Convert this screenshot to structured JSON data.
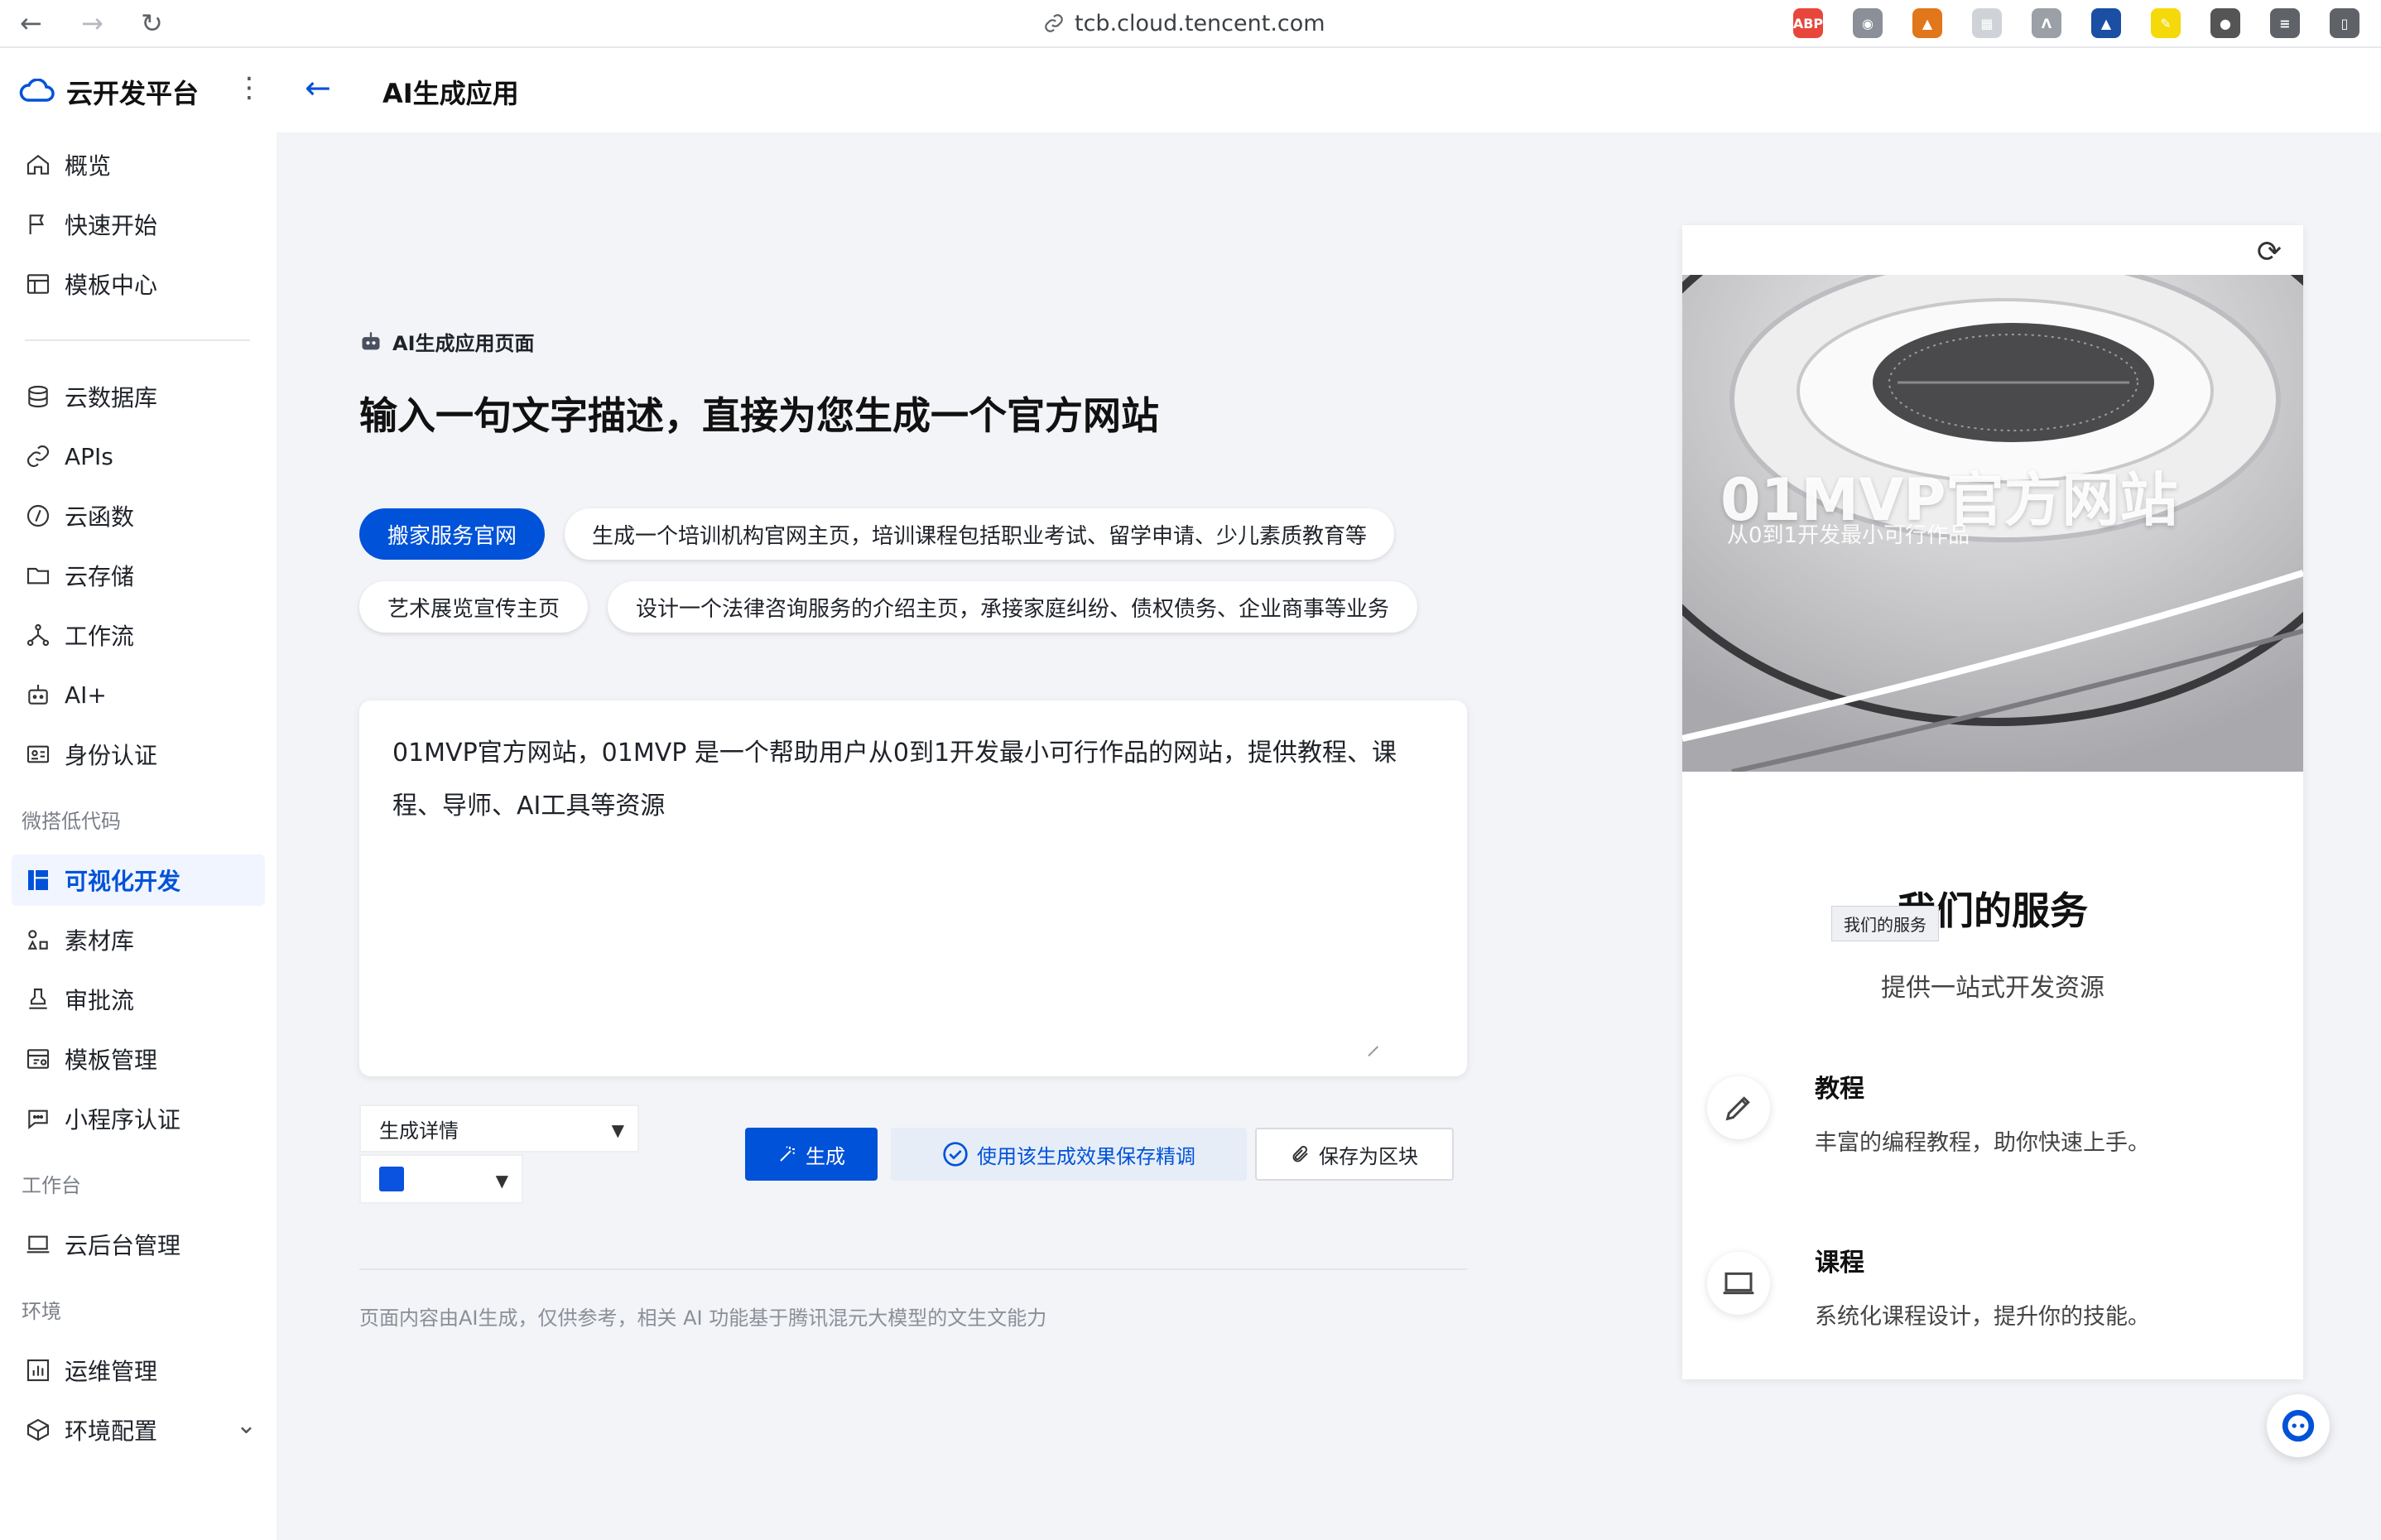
{
  "browser": {
    "url": "tcb.cloud.tencent.com",
    "back": "←",
    "forward": "→",
    "reload": "↻",
    "extensions": [
      {
        "icon": "adblock-icon",
        "label": "ABP",
        "color": "#e8463b"
      },
      {
        "icon": "camera-icon",
        "label": "◉",
        "color": "#8a8f98"
      },
      {
        "icon": "fox-icon",
        "label": "▲",
        "color": "#e2761b"
      },
      {
        "icon": "grid-icon",
        "label": "▦",
        "color": "#cfd3d8"
      },
      {
        "icon": "peak-icon",
        "label": "Λ",
        "color": "#9aa0a6"
      },
      {
        "icon": "mortarboard-icon",
        "label": "▲",
        "color": "#1a4fa3"
      },
      {
        "icon": "highlighter-icon",
        "label": "✎",
        "color": "#f5d90a"
      },
      {
        "icon": "avatar-ext-icon",
        "label": "●",
        "color": "#555555"
      },
      {
        "icon": "equalizer-icon",
        "label": "≡",
        "color": "#5f6368"
      },
      {
        "icon": "sidebar-toggle-icon",
        "label": "▯",
        "color": "#5f6368"
      }
    ]
  },
  "sidebar": {
    "brand": "云开发平台",
    "more": "⋮",
    "items_top": [
      {
        "name": "overview",
        "label": "概览",
        "icon": "home-icon"
      },
      {
        "name": "quick-start",
        "label": "快速开始",
        "icon": "flag-icon"
      },
      {
        "name": "template-center",
        "label": "模板中心",
        "icon": "template-icon"
      }
    ],
    "items_main": [
      {
        "name": "database",
        "label": "云数据库",
        "icon": "database-icon"
      },
      {
        "name": "apis",
        "label": "APIs",
        "icon": "link-icon"
      },
      {
        "name": "functions",
        "label": "云函数",
        "icon": "function-icon"
      },
      {
        "name": "storage",
        "label": "云存储",
        "icon": "folder-icon"
      },
      {
        "name": "workflow",
        "label": "工作流",
        "icon": "workflow-icon"
      },
      {
        "name": "ai-plus",
        "label": "AI+",
        "icon": "robot-icon"
      },
      {
        "name": "identity",
        "label": "身份认证",
        "icon": "id-card-icon"
      }
    ],
    "section_lowcode": "微搭低代码",
    "items_lowcode": [
      {
        "name": "visual-dev",
        "label": "可视化开发",
        "icon": "layout-icon",
        "active": true
      },
      {
        "name": "materials",
        "label": "素材库",
        "icon": "shapes-icon"
      },
      {
        "name": "approval",
        "label": "审批流",
        "icon": "stamp-icon"
      },
      {
        "name": "template-mgmt",
        "label": "模板管理",
        "icon": "template-manage-icon"
      },
      {
        "name": "miniprogram-auth",
        "label": "小程序认证",
        "icon": "chat-bubble-icon"
      }
    ],
    "section_workbench": "工作台",
    "items_workbench": [
      {
        "name": "cloud-admin",
        "label": "云后台管理",
        "icon": "laptop-icon"
      }
    ],
    "section_env": "环境",
    "items_env": [
      {
        "name": "ops",
        "label": "运维管理",
        "icon": "bar-chart-icon"
      },
      {
        "name": "env-config",
        "label": "环境配置",
        "icon": "cube-icon",
        "chevron": "⌄"
      }
    ]
  },
  "header": {
    "back": "←",
    "title": "AI生成应用"
  },
  "main": {
    "section_tag": "AI生成应用页面",
    "headline": "输入一句文字描述，直接为您生成一个官方网站",
    "chips": [
      "搬家服务官网",
      "生成一个培训机构官网主页，培训课程包括职业考试、留学申请、少儿素质教育等",
      "艺术展览宣传主页",
      "设计一个法律咨询服务的介绍主页，承接家庭纠纷、债权债务、企业商事等业务"
    ],
    "prompt_value": "01MVP官方网站，01MVP 是一个帮助用户从0到1开发最小可行作品的网站，提供教程、课程、导师、AI工具等资源",
    "detail_select": "生成详情",
    "color_swatch": "#0a52e0",
    "btn_generate": "生成",
    "btn_save_tune": "使用该生成效果保存精调",
    "btn_save_block": "保存为区块",
    "footnote": "页面内容由AI生成，仅供参考，相关 AI 功能基于腾讯混元大模型的文生文能力"
  },
  "preview": {
    "hero_title": "01MVP官方网站",
    "hero_subtitle": "从0到1开发最小可行作品",
    "services_title": "我们的服务",
    "services_tooltip": "我们的服务",
    "services_subtitle": "提供一站式开发资源",
    "features": [
      {
        "title": "教程",
        "desc": "丰富的编程教程，助你快速上手。",
        "icon": "pencil-icon"
      },
      {
        "title": "课程",
        "desc": "系统化课程设计，提升你的技能。",
        "icon": "laptop-icon"
      }
    ]
  },
  "colors": {
    "brand": "#0052d9",
    "active_bg": "#f0f5ff",
    "page_bg": "#f3f4f7"
  }
}
